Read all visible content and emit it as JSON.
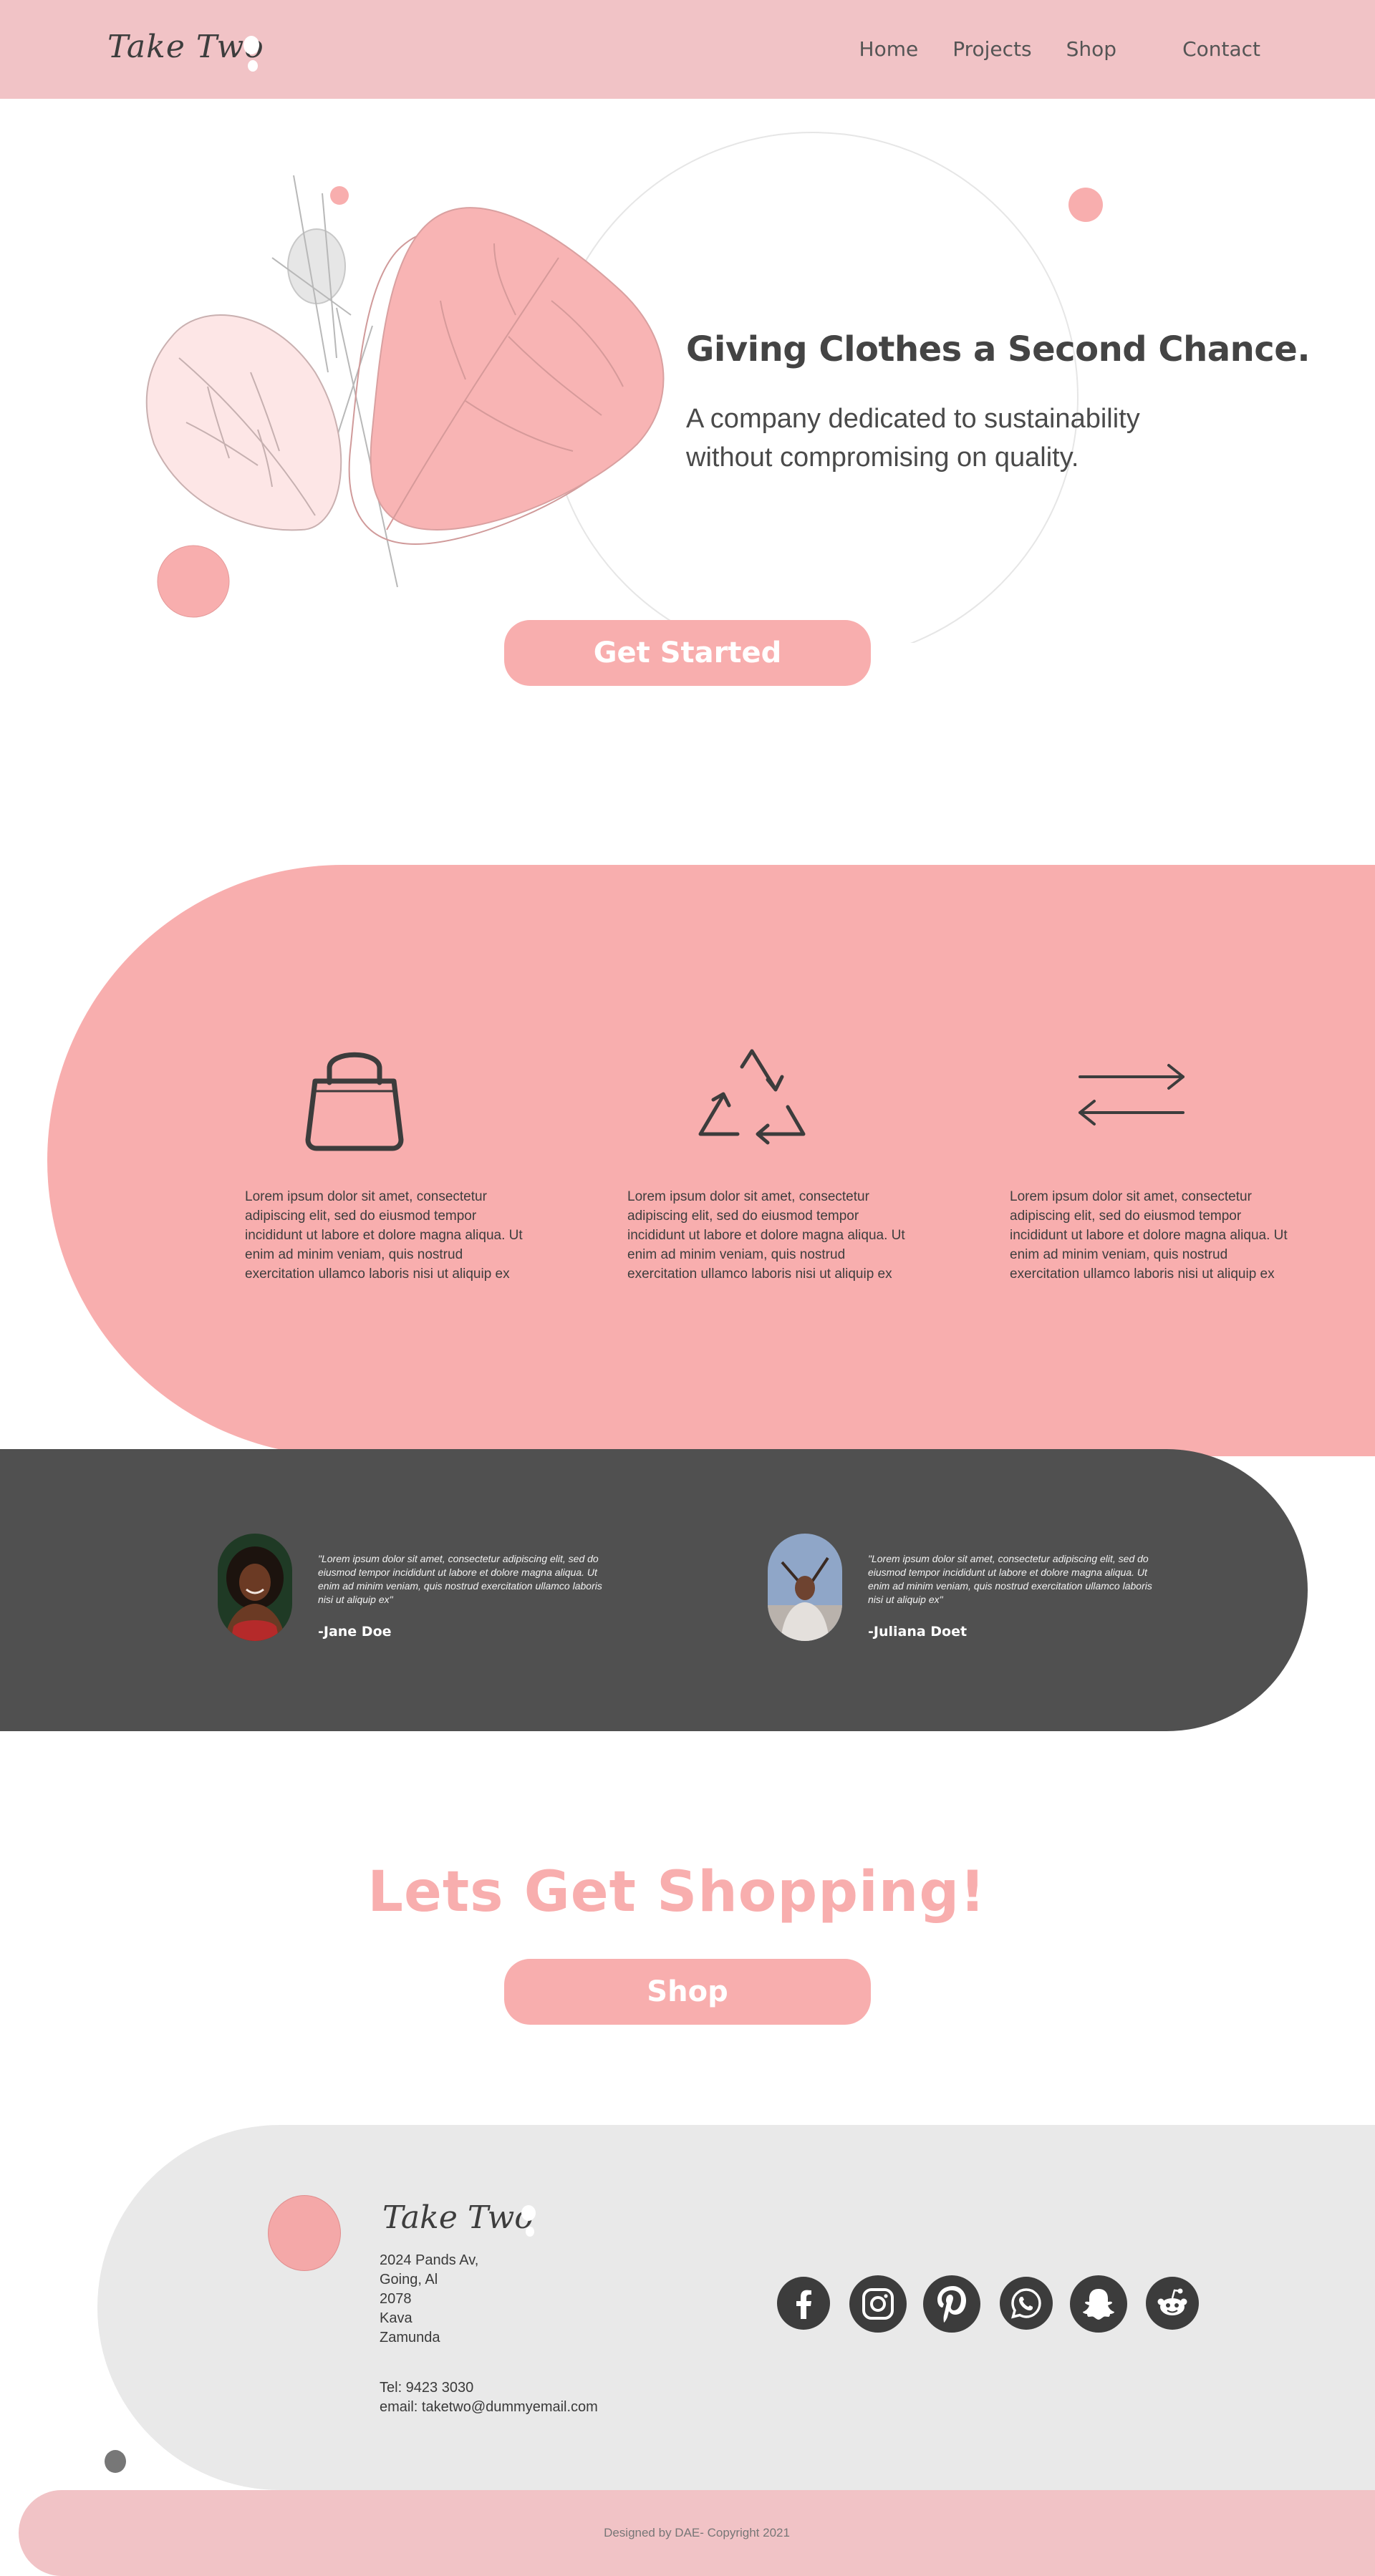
{
  "nav": {
    "logo": "Take Two",
    "links": [
      "Home",
      "Projects",
      "Shop",
      "Contact"
    ]
  },
  "hero": {
    "title": "Giving Clothes a Second Chance.",
    "subtitle": "A company dedicated to sustainability without compromising on quality.",
    "cta": "Get Started"
  },
  "features": [
    {
      "icon": "shopping-bag-icon",
      "text": "Lorem ipsum dolor sit amet, consectetur adipiscing elit, sed do eiusmod tempor incididunt ut labore et dolore magna aliqua. Ut enim ad minim veniam, quis nostrud exercitation ullamco laboris nisi ut aliquip ex"
    },
    {
      "icon": "recycle-icon",
      "text": "Lorem ipsum dolor sit amet, consectetur adipiscing elit, sed do eiusmod tempor incididunt ut labore et dolore magna aliqua. Ut enim ad minim veniam, quis nostrud exercitation ullamco laboris nisi ut aliquip ex"
    },
    {
      "icon": "exchange-arrows-icon",
      "text": "Lorem ipsum dolor sit amet, consectetur adipiscing elit, sed do eiusmod tempor incididunt ut labore et dolore magna aliqua. Ut enim ad minim veniam, quis nostrud exercitation ullamco laboris nisi ut aliquip ex"
    }
  ],
  "testimonials": [
    {
      "quote": "\"Lorem ipsum dolor sit amet, consectetur adipiscing elit, sed do eiusmod tempor incididunt ut labore et dolore magna aliqua. Ut enim ad minim veniam, quis nostrud exercitation ullamco laboris nisi ut aliquip ex\"",
      "name": "-Jane Doe"
    },
    {
      "quote": "\"Lorem ipsum dolor sit amet, consectetur adipiscing elit, sed do eiusmod tempor incididunt ut labore et dolore magna aliqua. Ut enim ad minim veniam, quis nostrud exercitation ullamco laboris nisi ut aliquip ex\"",
      "name": "-Juliana Doet"
    }
  ],
  "cta": {
    "title": "Lets Get Shopping!",
    "button": "Shop"
  },
  "footer": {
    "logo": "Take Two",
    "address": [
      "2024 Pands Av,",
      "Going, Al",
      "2078",
      "Kava",
      "Zamunda"
    ],
    "tel": "Tel: 9423 3030",
    "email": "email: taketwo@dummyemail.com",
    "social": [
      "facebook-icon",
      "instagram-icon",
      "pinterest-icon",
      "whatsapp-icon",
      "snapchat-icon",
      "reddit-icon"
    ],
    "copyright": "Designed by DAE- Copyright 2021"
  },
  "colors": {
    "nav_pink": "#f1c3c6",
    "accent_pink": "#f8aeae",
    "dark_gray": "#505050",
    "light_gray": "#e9e9e9",
    "text_dark": "#444444"
  }
}
